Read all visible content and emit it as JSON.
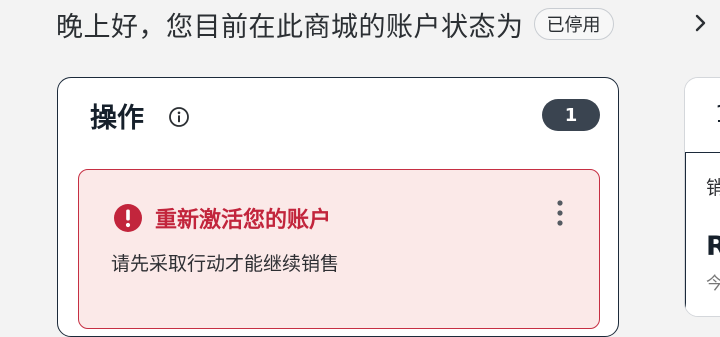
{
  "header": {
    "greeting": "晚上好，您目前在此商城的账户状态为",
    "status_badge": "已停用"
  },
  "actions_card": {
    "title": "操作",
    "count": "1",
    "alert": {
      "title": "重新激活您的账户",
      "description": "请先采取行动才能继续销售"
    }
  },
  "side_card": {
    "top_text": "1",
    "sales_label": "销",
    "value_text": "R",
    "today_label": "今"
  },
  "colors": {
    "alert_red": "#c2253c",
    "alert_bg": "#fbe9e8",
    "pill_bg": "#3a4450"
  }
}
